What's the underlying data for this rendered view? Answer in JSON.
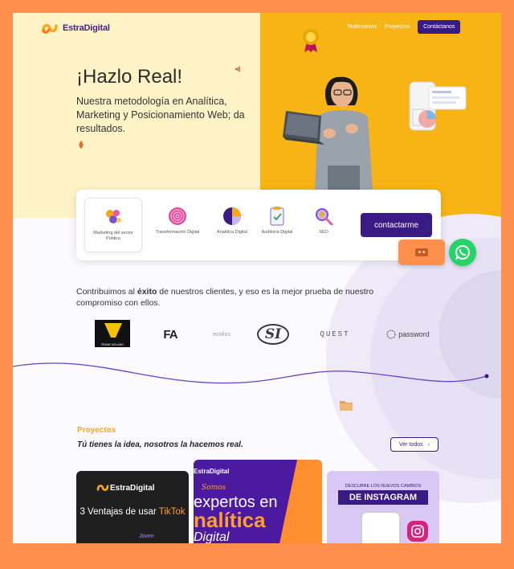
{
  "brand": {
    "name": "EstraDigital"
  },
  "nav": {
    "links": [
      "Testimonios",
      "Proyectos"
    ],
    "cta": "Contáctanos"
  },
  "hero": {
    "title": "¡Hazlo Real!",
    "subtitle": "Nuestra metodología en Analítica, Marketing y Posicionamiento Web; da resultados."
  },
  "services": {
    "items": [
      {
        "label": "Marketing del sector Público",
        "icon": "megaphone-icon",
        "active": true
      },
      {
        "label": "Transformación Digital",
        "icon": "fingerprint-icon",
        "active": false
      },
      {
        "label": "Analítica Digital",
        "icon": "pie-chart-icon",
        "active": false
      },
      {
        "label": "Auditoría Digital",
        "icon": "checklist-icon",
        "active": false
      },
      {
        "label": "SEO",
        "icon": "magnifier-icon",
        "active": false
      }
    ],
    "cta": "contactarme"
  },
  "clients": {
    "text_before": "Contribuimos al ",
    "text_bold": "éxito",
    "text_after": " de nuestros clientes, y eso es la mejor prueba de nuestro compromiso con ellos.",
    "logos": [
      "FRANK MOLANO",
      "FA",
      "ecolins",
      "SI",
      "QUEST",
      "password"
    ]
  },
  "projects": {
    "kicker": "Proyectos",
    "title": "Tú tienes la idea, nosotros la hacemos real.",
    "see_all": "Ver todos",
    "cards": [
      {
        "brand": "EstraDigital",
        "headline": "3 Ventajas de usar ",
        "headline_accent": "TikTok",
        "tag": "Joven"
      },
      {
        "brand": "EstraDigital",
        "kicker": "Somos",
        "line1": "expertos en",
        "line2": "nalítica",
        "line3": "Digital"
      },
      {
        "kicker": "DESCUBRE LOS NUEVOS CAMBIOS",
        "title": "DE INSTAGRAM"
      }
    ]
  },
  "colors": {
    "primary": "#3a1a85",
    "accent": "#f8b414",
    "frame": "#ff8f4d"
  }
}
